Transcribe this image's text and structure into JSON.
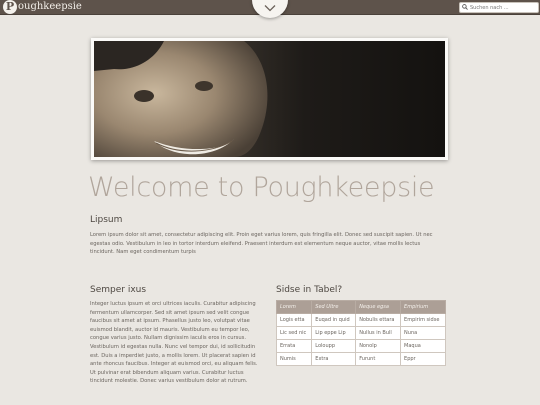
{
  "header": {
    "logo_letter": "P",
    "site_name": "oughkeepsie",
    "search_placeholder": "Suchen nach ..."
  },
  "main": {
    "title": "Welcome to Poughkeepsie",
    "section1": {
      "heading": "Lipsum",
      "text": "Lorem ipsum dolor sit amet, consectetur adipiscing elit. Proin eget varius lorem, quis fringilla elit. Donec sed suscipit sapien. Ut nec egestas odio. Vestibulum in leo in tortor interdum eleifend. Praesent interdum est elementum neque auctor, vitae mollis lectus tincidunt. Nam eget condimentum turpis"
    },
    "section2": {
      "heading": "Semper ixus",
      "text": "Integer luctus ipsum et orci ultrices iaculis. Curabitur adipiscing fermentum ullamcorper. Sed sit amet ipsum sed velit congue faucibus sit amet at ipsum. Phasellus justo leo, volutpat vitae euismod blandit, auctor id mauris. Vestibulum eu tempor leo, congue varius justo. Nullam dignissim iaculis eros in cursus. Vestibulum id egestas nulla. Nunc vel tempor dui, id sollicitudin est. Duis a imperdiet justo, a mollis lorem. Ut placerat sapien id ante rhoncus faucibus. Integer at euismod orci, eu aliquam felis. Ut pulvinar erat bibendum aliquam varius. Curabitur luctus tincidunt molestie. Donec varius vestibulum dolor at rutrum."
    },
    "section3": {
      "heading": "Sidse in Tabel?",
      "table": {
        "headers": [
          "Lorem",
          "Sed Ultre",
          "Neque egsa",
          "Empirium"
        ],
        "rows": [
          [
            "Logis etta",
            "Euqad in quid",
            "Nobulis ettara",
            "Empirim sidse"
          ],
          [
            "Lic sed nic",
            "Lip eppe Lip",
            "Nullus in Bull",
            "Nuna"
          ],
          [
            "Errata",
            "Loloupp",
            "Nonolp",
            "Maqua"
          ],
          [
            "Numis",
            "Extra",
            "Furunt",
            "Eppr"
          ]
        ]
      }
    }
  },
  "colors": {
    "topbar": "#5e534b",
    "background": "#eae7e2",
    "title": "#b0a59b",
    "table_header": "#ac9f96"
  },
  "icons": {
    "tab": "chevron-down-icon",
    "search": "search-icon"
  }
}
